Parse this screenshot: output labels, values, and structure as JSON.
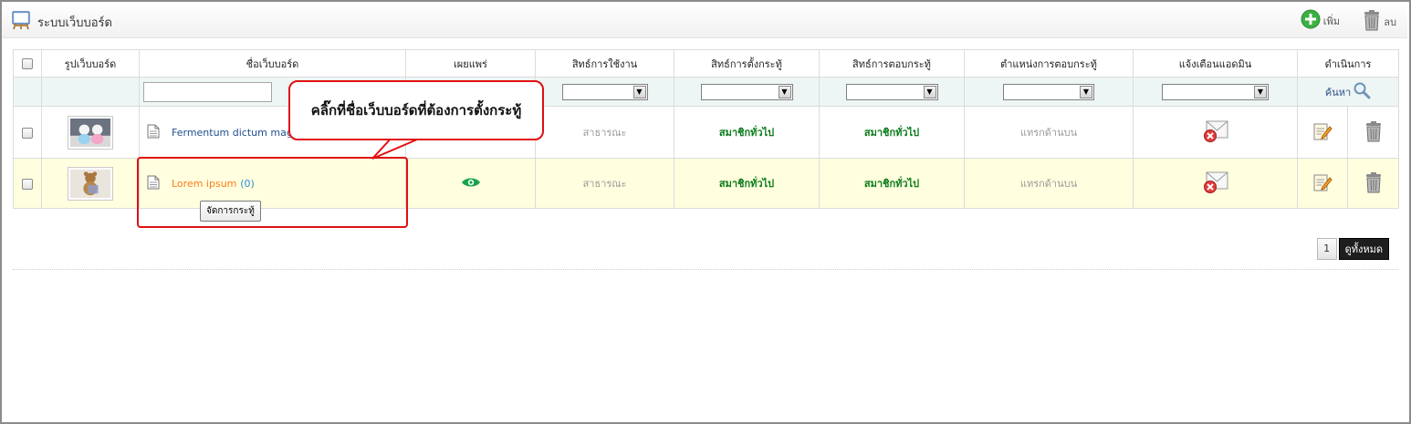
{
  "window": {
    "title": "ระบบเว็บบอร์ด",
    "add_label": "เพิ่ม",
    "delete_label": "ลบ"
  },
  "table": {
    "columns": [
      "รูปเว็บบอร์ด",
      "ชื่อเว็บบอร์ด",
      "เผยแพร่",
      "สิทธ์การใช้งาน",
      "สิทธ์การตั้งกระทู้",
      "สิทธ์การตอบกระทู้",
      "ตำแหน่งการตอบกระทู้",
      "แจ้งเตือนแอดมิน",
      "ดำเนินการ"
    ],
    "filter": {
      "name_value": "",
      "search_label": "ค้นหา"
    },
    "rows": [
      {
        "name": "Fermentum dictum mag",
        "count": "",
        "usage": "สาธารณะ",
        "post_right": "สมาชิกทั่วไป",
        "reply_right": "สมาชิกทั่วไป",
        "reply_position": "แทรกด้านบน"
      },
      {
        "name": "Lorem ipsum",
        "count": "(0)",
        "usage": "สาธารณะ",
        "post_right": "สมาชิกทั่วไป",
        "reply_right": "สมาชิกทั่วไป",
        "reply_position": "แทรกด้านบน"
      }
    ]
  },
  "tooltip": "จัดการกระทู้",
  "callout": "คลิ๊กที่ชื่อเว็บบอร์ดที่ต้องการตั้งกระทู้",
  "pagination": {
    "current_page": "1",
    "view_all": "ดูทั้งหมด"
  },
  "icons": {
    "title": "easel-icon",
    "add": "plus-circle-icon",
    "delete": "trash-icon",
    "search": "magnifier-icon",
    "doc": "document-icon",
    "published": "eye-icon",
    "notify_off": "mail-blocked-icon",
    "edit": "edit-note-icon"
  },
  "colors": {
    "link_blue": "#1f4e8f",
    "link_orange": "#ff7a16",
    "count_blue": "#2b8cd1",
    "green_text": "#0a7a1a",
    "highlight_row": "#ffffdf",
    "annotation_red": "#e01010",
    "eye_green": "#1aa34a"
  }
}
